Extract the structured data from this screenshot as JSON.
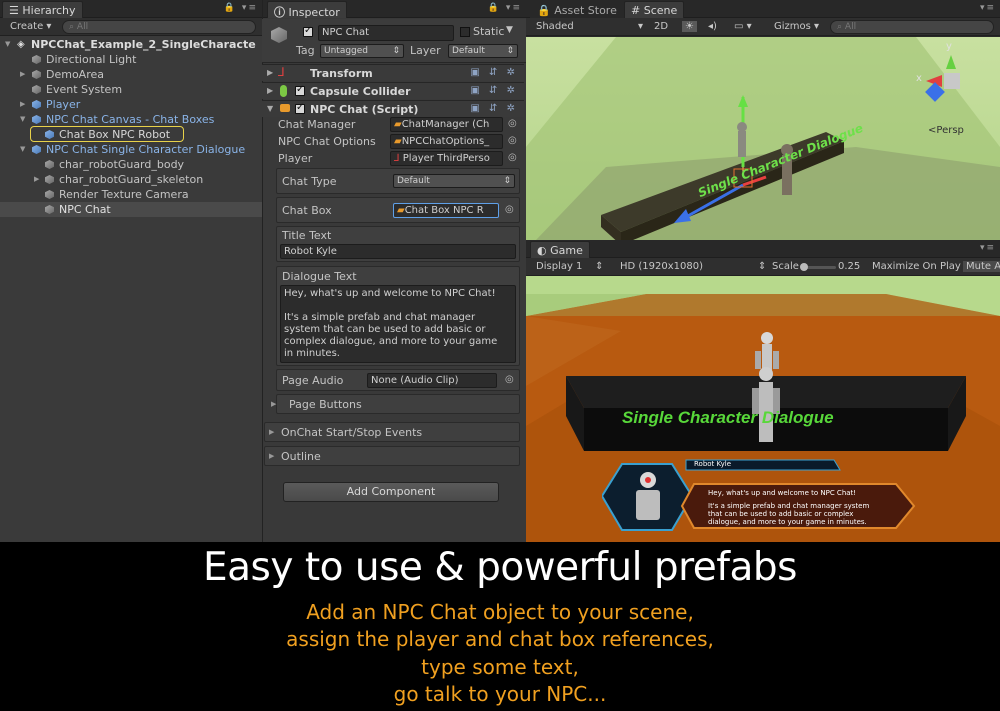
{
  "hierarchy": {
    "tab": "Hierarchy",
    "create": "Create",
    "search_placeholder": "All",
    "scene_name": "NPCChat_Example_2_SingleCharacte",
    "items": [
      {
        "label": "Directional Light"
      },
      {
        "label": "DemoArea"
      },
      {
        "label": "Event System"
      },
      {
        "label": "Player"
      },
      {
        "label": "NPC Chat Canvas - Chat Boxes"
      },
      {
        "label": "Chat Box NPC Robot"
      },
      {
        "label": "NPC Chat Single Character Dialogue"
      },
      {
        "label": "char_robotGuard_body"
      },
      {
        "label": "char_robotGuard_skeleton"
      },
      {
        "label": "Render Texture Camera"
      },
      {
        "label": "NPC Chat"
      }
    ]
  },
  "inspector": {
    "tab": "Inspector",
    "object_name": "NPC Chat",
    "static_label": "Static",
    "tag_label": "Tag",
    "tag_value": "Untagged",
    "layer_label": "Layer",
    "layer_value": "Default",
    "components": {
      "transform": "Transform",
      "collider": "Capsule Collider",
      "script": "NPC Chat (Script)"
    },
    "props": {
      "chat_manager_label": "Chat Manager",
      "chat_manager_value": "ChatManager (Ch",
      "chat_options_label": "NPC Chat Options",
      "chat_options_value": "NPCChatOptions_",
      "player_label": "Player",
      "player_value": "Player ThirdPerso",
      "chat_type_label": "Chat Type",
      "chat_type_value": "Default",
      "chat_box_label": "Chat Box",
      "chat_box_value": "Chat Box NPC R",
      "title_text_label": "Title Text",
      "title_text_value": "Robot Kyle",
      "dialogue_label": "Dialogue Text",
      "dialogue_line1": "Hey, what's up and welcome to NPC Chat!",
      "dialogue_line2": "It's a simple prefab and chat manager",
      "dialogue_line3": "system that can be used to add basic or",
      "dialogue_line4": "complex dialogue, and more to your game",
      "dialogue_line5": "in minutes.",
      "page_audio_label": "Page Audio",
      "page_audio_value": "None (Audio Clip)",
      "page_buttons": "Page Buttons",
      "events": "OnChat Start/Stop Events",
      "outline": "Outline",
      "add_component": "Add Component"
    }
  },
  "scene": {
    "tab_asset_store": "Asset Store",
    "tab_scene": "Scene",
    "shaded": "Shaded",
    "mode_2d": "2D",
    "gizmos": "Gizmos",
    "search_placeholder": "All",
    "persp": "Persp",
    "gizmo_y": "y",
    "gizmo_x": "x",
    "platform_text": "Single Character Dialogue"
  },
  "game": {
    "tab": "Game",
    "display": "Display 1",
    "resolution": "HD (1920x1080)",
    "scale_label": "Scale",
    "scale_value": "0.25",
    "maximize": "Maximize On Play",
    "mute": "Mute A",
    "platform_text": "Single Character Dialogue",
    "chat_title": "Robot Kyle",
    "chat_line1": "Hey, what's up and welcome to NPC Chat!",
    "chat_line2": "It's a simple prefab and chat manager system",
    "chat_line3": "that can be used to add basic or complex",
    "chat_line4": "dialogue, and more to your game in minutes."
  },
  "caption": {
    "headline": "Easy to use & powerful prefabs",
    "line1": "Add an NPC Chat object to your scene,",
    "line2": "assign the player and chat box references,",
    "line3": "type some text,",
    "line4": "go talk to your NPC..."
  },
  "colors": {
    "orange_caption": "#f0a020",
    "accent_blue": "#5fa0e8",
    "ground_orange": "#b85a10",
    "sky_green": "#b7d98c"
  }
}
